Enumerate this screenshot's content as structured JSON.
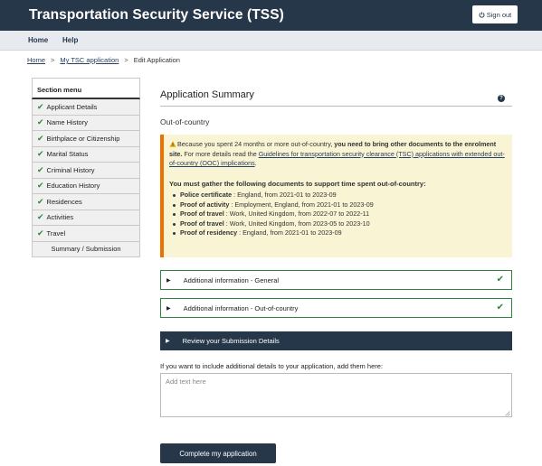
{
  "header": {
    "title": "Transportation Security Service (TSS)",
    "signout_label": "Sign out"
  },
  "nav": {
    "items": [
      {
        "label": "Home"
      },
      {
        "label": "Help"
      }
    ]
  },
  "breadcrumb": {
    "home": "Home",
    "application": "My TSC application",
    "current": "Edit Application"
  },
  "sidebar": {
    "title": "Section menu",
    "items": [
      {
        "label": "Applicant Details",
        "done": true
      },
      {
        "label": "Name History",
        "done": true
      },
      {
        "label": "Birthplace or Citizenship",
        "done": true
      },
      {
        "label": "Marital Status",
        "done": true
      },
      {
        "label": "Criminal History",
        "done": true
      },
      {
        "label": "Education History",
        "done": true
      },
      {
        "label": "Residences",
        "done": true
      },
      {
        "label": "Activities",
        "done": true
      },
      {
        "label": "Travel",
        "done": true
      },
      {
        "label": "Summary / Submission",
        "done": false
      }
    ]
  },
  "main": {
    "title": "Application Summary",
    "help_icon": "?",
    "section_heading": "Out-of-country",
    "warning": {
      "intro": "Because you spent 24 months or more out-of-country, ",
      "intro_bold": "you need to bring other documents to the enrolment site.",
      "more": " For more details read the ",
      "link": "Guidelines for transportation security clearance (TSC) applications with extended out-of-country (OOC) implications",
      "end": ".",
      "gather_heading": "You must gather the following documents to support time spent out-of-country:",
      "documents": [
        {
          "label": "Police certificate",
          "detail": " : England, from 2021-01 to 2023-09"
        },
        {
          "label": "Proof of activity",
          "detail": " : Employment, England, from 2021-01 to 2023-09"
        },
        {
          "label": "Proof of travel",
          "detail": " : Work, United Kingdom, from 2022-07 to 2022-11"
        },
        {
          "label": "Proof of travel",
          "detail": " : Work, United Kingdom, from 2023-05 to 2023-10"
        },
        {
          "label": "Proof of residency",
          "detail": " : England, from 2021-01 to 2023-09"
        }
      ]
    },
    "accordions": [
      {
        "label": "Additional information - General"
      },
      {
        "label": "Additional information - Out-of-country"
      }
    ],
    "review_label": "Review your Submission Details",
    "additional_label": "If you want to include additional details to your application, add them here:",
    "additional_placeholder": "Add text here",
    "additional_value": "",
    "complete_button": "Complete my application"
  },
  "colors": {
    "brand": "#26374a",
    "success": "#2e8540",
    "warning_bg": "#f9f4d4",
    "warning_border": "#ee7100"
  }
}
